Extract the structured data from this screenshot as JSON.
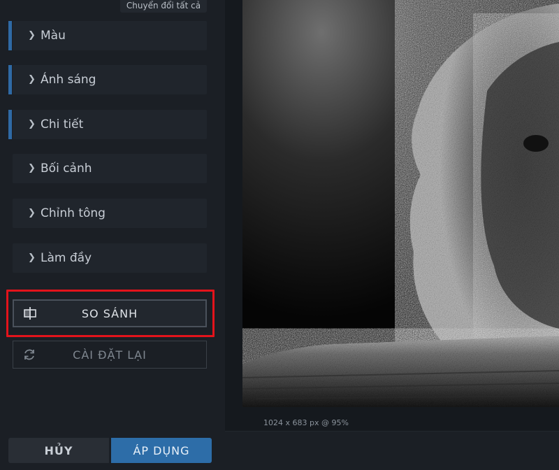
{
  "sidebar": {
    "toggle_all": "Chuyển đổi tất cả",
    "panels": [
      {
        "label": "Màu",
        "accent": true
      },
      {
        "label": "Ánh sáng",
        "accent": true
      },
      {
        "label": "Chi tiết",
        "accent": true
      },
      {
        "label": "Bối cảnh",
        "accent": false
      },
      {
        "label": "Chỉnh tông",
        "accent": false
      },
      {
        "label": "Làm đầy",
        "accent": false
      }
    ],
    "compare_label": "SO SÁNH",
    "reset_label": "CÀI ĐẶT LẠI",
    "cancel_label": "HỦY",
    "apply_label": "ÁP DỤNG"
  },
  "canvas": {
    "image_info": "1024 x 683 px @ 95%"
  },
  "icons": {
    "panel_chevron": "chevron-right-icon",
    "compare": "compare-split-icon",
    "reset": "refresh-icon"
  },
  "colors": {
    "accent": "#2f6aa5",
    "apply_button": "#2d6da8",
    "highlight": "#e3131b"
  }
}
